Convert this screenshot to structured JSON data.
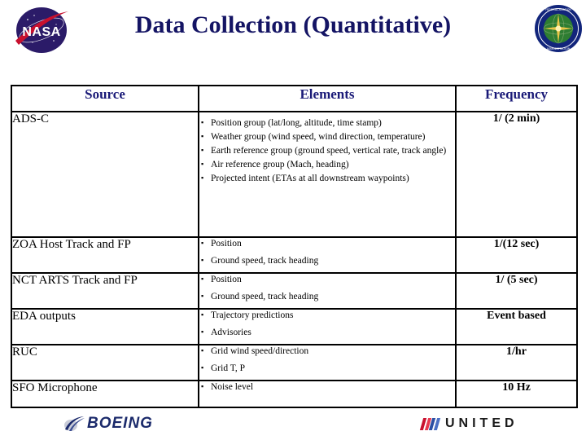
{
  "header": {
    "title": "Data Collection (Quantitative)",
    "title_color": "#141464",
    "nasa_logo_label": "NASA",
    "faa_logo_label": "Federal Aviation Administration"
  },
  "table": {
    "columns": [
      "Source",
      "Elements",
      "Frequency"
    ],
    "header_color": "#1a1a78",
    "rows": [
      {
        "source": "ADS-C",
        "elements": [
          "Position group (lat/long, altitude, time stamp)",
          "Weather group (wind speed, wind direction, temperature)",
          "Earth reference group (ground speed, vertical rate, track angle)",
          "Air reference group (Mach, heading)",
          "Projected intent (ETAs at all downstream waypoints)"
        ],
        "frequency": "1/ (2 min)"
      },
      {
        "source": "ZOA Host Track and FP",
        "elements": [
          "Position",
          "Ground speed, track heading"
        ],
        "frequency": "1/(12 sec)"
      },
      {
        "source": "NCT ARTS Track and FP",
        "elements": [
          "Position",
          "Ground speed, track heading"
        ],
        "frequency": "1/ (5 sec)"
      },
      {
        "source": "EDA outputs",
        "elements": [
          "Trajectory predictions",
          "Advisories"
        ],
        "frequency": "Event based"
      },
      {
        "source": "RUC",
        "elements": [
          "Grid wind speed/direction",
          "Grid T, P"
        ],
        "frequency": "1/hr"
      },
      {
        "source": "SFO Microphone",
        "elements": [
          "Noise level"
        ],
        "frequency": "10 Hz"
      }
    ]
  },
  "footer": {
    "boeing_label": "BOEING",
    "boeing_color": "#1b2a6b",
    "united_label": "UNITED",
    "united_color": "#1a1a1a",
    "united_stripe_colors": [
      "#c8102e",
      "#e8384f",
      "#2b4ea2",
      "#4a6fc4"
    ]
  }
}
